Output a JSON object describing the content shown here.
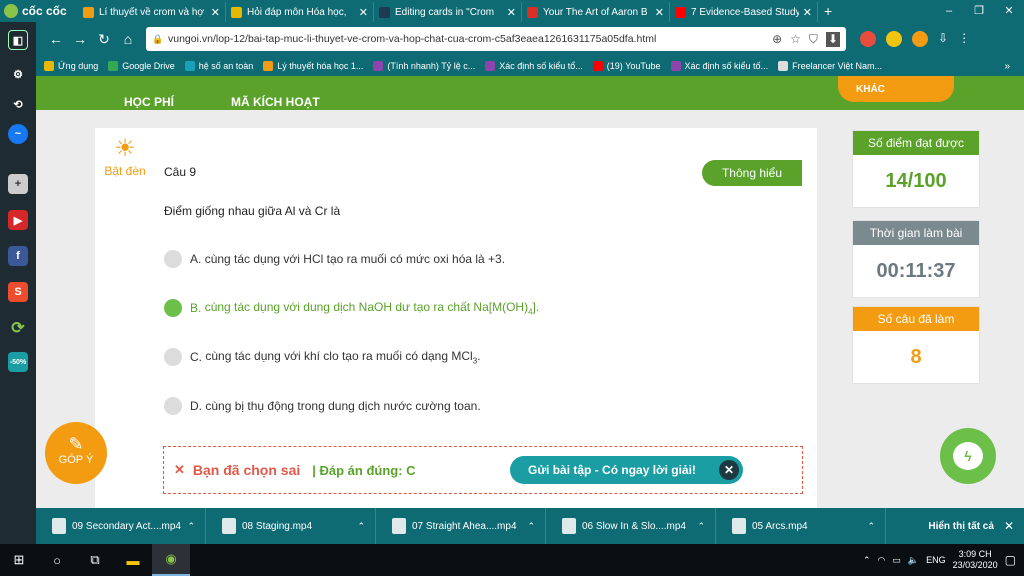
{
  "browser": {
    "brand": "cốc cốc",
    "tabs": [
      {
        "label": "Lí thuyết về crom và hợ",
        "icon_color": "#f39c12",
        "active": false
      },
      {
        "label": "Hỏi đáp môn Hóa học, ",
        "icon_color": "#e6b800",
        "active": false
      },
      {
        "label": "Editing cards in \"Crom",
        "icon_color": "#1d3a52",
        "active": false
      },
      {
        "label": "Your The Art of Aaron B",
        "icon_color": "#d93025",
        "active": false
      },
      {
        "label": "7 Evidence-Based Study",
        "icon_color": "#ff0000",
        "active": false
      }
    ],
    "url": "vungoi.vn/lop-12/bai-tap-muc-li-thuyet-ve-crom-va-hop-chat-cua-crom-c5af3eaea1261631175a05dfa.html",
    "bookmarks": [
      {
        "label": "Ứng dụng",
        "color": "#e6b800"
      },
      {
        "label": "Google Drive",
        "color": "#34a853"
      },
      {
        "label": "hệ số an toàn",
        "color": "#17a2b8"
      },
      {
        "label": "Lý thuyết hóa học 1...",
        "color": "#f39c12"
      },
      {
        "label": "(Tính nhanh) Tỷ lệ c...",
        "color": "#8e44ad"
      },
      {
        "label": "Xác định số kiểu tổ...",
        "color": "#8e44ad"
      },
      {
        "label": "(19) YouTube",
        "color": "#ff0000"
      },
      {
        "label": "Xác định số kiểu tố...",
        "color": "#8e44ad"
      },
      {
        "label": "Freelancer Việt Nam...",
        "color": "#dddddd"
      }
    ]
  },
  "site_nav": {
    "fee": "HỌC PHÍ",
    "activation": "MÃ KÍCH HOẠT",
    "other": "KHÁC"
  },
  "quiz": {
    "light_label": "Bật đèn",
    "question_number": "Câu 9",
    "level_badge": "Thông hiểu",
    "question": "Điểm giống nhau giữa Al và Cr là",
    "options": [
      {
        "letter": "A.",
        "text": "cùng tác dụng với HCl tạo ra muối có mức oxi hóa là +3.",
        "selected": false
      },
      {
        "letter": "B.",
        "text": "cùng tác dụng với dung dịch NaOH dư tạo ra chất Na[M(OH)4].",
        "selected": true
      },
      {
        "letter": "C.",
        "text": "cùng tác dụng với khí clo tạo ra muối có dạng MCl3.",
        "selected": false
      },
      {
        "letter": "D.",
        "text": "cùng bị thụ động trong dung dịch nước cường toan.",
        "selected": false
      }
    ],
    "result_wrong": "Bạn đã chọn sai",
    "result_correct": "| Đáp án đúng: C",
    "submit_label": "Gửi bài tập - Có ngay lời giải!"
  },
  "stats": {
    "score_label": "Số điểm đạt được",
    "score_value": "14/100",
    "time_label": "Thời gian làm bài",
    "time_value": "00:11:37",
    "count_label": "Số câu đã làm",
    "count_value": "8",
    "colors": {
      "green": "#5aa22a",
      "gray": "#7b8a8f",
      "orange": "#f39c12",
      "teal": "#1a9ea3"
    }
  },
  "feedback_label": "GÓP Ý",
  "downloads": {
    "items": [
      "09 Secondary Act....mp4",
      "08 Staging.mp4",
      "07 Straight Ahea....mp4",
      "06 Slow In & Slo....mp4",
      "05 Arcs.mp4"
    ],
    "show_all": "Hiển thị tất cả"
  },
  "taskbar": {
    "language": "ENG",
    "time": "3:09 CH",
    "date": "23/03/2020"
  }
}
